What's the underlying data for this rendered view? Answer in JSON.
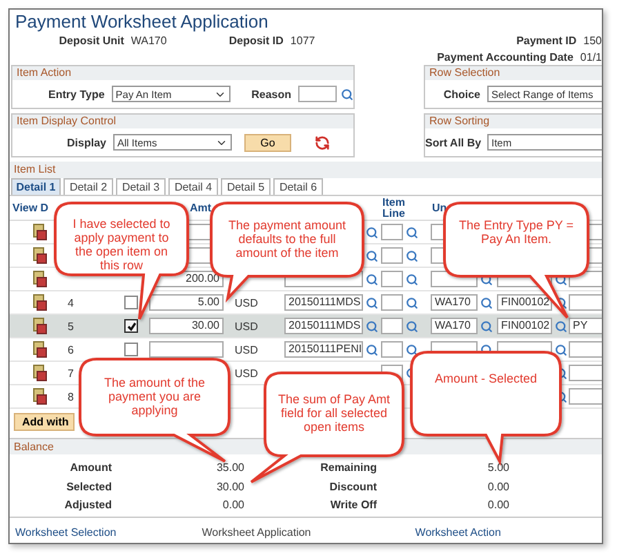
{
  "title": "Payment Worksheet Application",
  "header_fields": [
    {
      "label": "Deposit Unit",
      "value": "WA170"
    },
    {
      "label": "Deposit ID",
      "value": "1077"
    },
    {
      "label": "Payment ID",
      "value": "150"
    },
    {
      "label": "Payment Accounting Date",
      "value": "01/1"
    }
  ],
  "item_action": {
    "title": "Item Action",
    "entry_type": {
      "label": "Entry Type",
      "value": "Pay An Item"
    },
    "reason": {
      "label": "Reason"
    }
  },
  "row_selection": {
    "title": "Row Selection",
    "choice": {
      "label": "Choice",
      "value": "Select Range of Items"
    }
  },
  "item_display_control": {
    "title": "Item Display Control",
    "display": {
      "label": "Display",
      "value": "All Items"
    },
    "go_button": "Go"
  },
  "row_sorting": {
    "title": "Row Sorting",
    "sort": {
      "label": "Sort All By",
      "value": "Item"
    }
  },
  "item_list": {
    "title": "Item List",
    "tabs": [
      {
        "label": "Detail 1",
        "selected": true
      },
      {
        "label": "Detail 2",
        "selected": false
      },
      {
        "label": "Detail 3",
        "selected": false
      },
      {
        "label": "Detail 4",
        "selected": false
      },
      {
        "label": "Detail 5",
        "selected": false
      },
      {
        "label": "Detail 6",
        "selected": false
      }
    ],
    "headers": {
      "view": "View D",
      "pay_amt": "Amt",
      "item_line": "Item Line",
      "unit": "Un"
    },
    "rows": [
      {
        "highlighted": false
      },
      {
        "highlighted": false
      },
      {
        "highlighted": false,
        "pay_amt": "200.00"
      },
      {
        "highlighted": false,
        "number": "4",
        "checked": false,
        "pay_amt": "5.00",
        "currency": "USD",
        "date": "20150111MDS",
        "unit": "WA170",
        "item_id": "FIN00102"
      },
      {
        "highlighted": true,
        "number": "5",
        "checked": true,
        "pay_amt": "30.00",
        "currency": "USD",
        "date": "20150111MDS",
        "unit": "WA170",
        "item_id": "FIN00102",
        "entry_type": "PY"
      },
      {
        "highlighted": false,
        "number": "6",
        "checked": false,
        "currency": "USD",
        "date": "20150111PENI"
      },
      {
        "highlighted": false,
        "number": "7",
        "currency": "USD"
      },
      {
        "highlighted": false,
        "number": "8"
      }
    ],
    "add_button": "Add with"
  },
  "balance": {
    "title": "Balance",
    "left": [
      {
        "label": "Amount",
        "value": "35.00"
      },
      {
        "label": "Selected",
        "value": "30.00"
      },
      {
        "label": "Adjusted",
        "value": "0.00"
      }
    ],
    "right": [
      {
        "label": "Remaining",
        "value": "5.00"
      },
      {
        "label": "Discount",
        "value": "0.00"
      },
      {
        "label": "Write Off",
        "value": "0.00"
      }
    ]
  },
  "footer": [
    {
      "kind": "link",
      "label": "Worksheet Selection"
    },
    {
      "kind": "text",
      "label": "Worksheet Application"
    },
    {
      "kind": "link",
      "label": "Worksheet Action"
    }
  ],
  "callouts": [
    {
      "text": "I have selected to apply payment to the open item on this row"
    },
    {
      "text": "The payment amount defaults to the full amount of the item"
    },
    {
      "text": "The Entry Type PY = Pay An Item."
    },
    {
      "text": "The amount of the payment you are applying"
    },
    {
      "text": "The sum of Pay Amt field for all selected open items"
    },
    {
      "text": "Amount - Selected"
    }
  ]
}
